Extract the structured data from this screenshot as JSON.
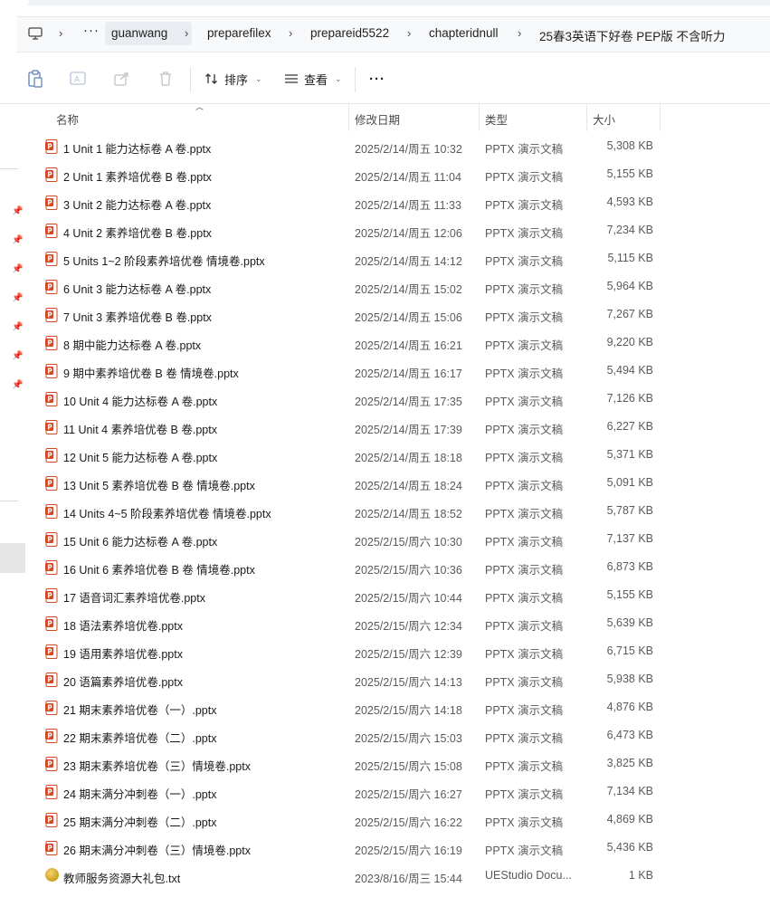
{
  "breadcrumb": {
    "more": "···",
    "items": [
      "guanwang",
      "preparefilex",
      "prepareid5522",
      "chapteridnull",
      "25春3英语下好卷 PEP版 不含听力"
    ]
  },
  "toolbar": {
    "sort_label": "排序",
    "view_label": "查看",
    "more": "···"
  },
  "columns": {
    "name": "名称",
    "date": "修改日期",
    "type": "类型",
    "size": "大小"
  },
  "files": [
    {
      "name": "1 Unit 1 能力达标卷 A 卷.pptx",
      "date": "2025/2/14/周五 10:32",
      "type": "PPTX 演示文稿",
      "size": "5,308 KB",
      "icon": "pptx-icon"
    },
    {
      "name": "2 Unit 1 素养培优卷 B 卷.pptx",
      "date": "2025/2/14/周五 11:04",
      "type": "PPTX 演示文稿",
      "size": "5,155 KB",
      "icon": "pptx-icon"
    },
    {
      "name": "3 Unit 2 能力达标卷 A 卷.pptx",
      "date": "2025/2/14/周五 11:33",
      "type": "PPTX 演示文稿",
      "size": "4,593 KB",
      "icon": "pptx-icon"
    },
    {
      "name": "4 Unit 2 素养培优卷 B 卷.pptx",
      "date": "2025/2/14/周五 12:06",
      "type": "PPTX 演示文稿",
      "size": "7,234 KB",
      "icon": "pptx-icon"
    },
    {
      "name": "5 Units 1~2 阶段素养培优卷 情境卷.pptx",
      "date": "2025/2/14/周五 14:12",
      "type": "PPTX 演示文稿",
      "size": "5,115 KB",
      "icon": "pptx-icon"
    },
    {
      "name": "6 Unit 3 能力达标卷 A 卷.pptx",
      "date": "2025/2/14/周五 15:02",
      "type": "PPTX 演示文稿",
      "size": "5,964 KB",
      "icon": "pptx-icon"
    },
    {
      "name": "7 Unit 3 素养培优卷 B 卷.pptx",
      "date": "2025/2/14/周五 15:06",
      "type": "PPTX 演示文稿",
      "size": "7,267 KB",
      "icon": "pptx-icon"
    },
    {
      "name": "8 期中能力达标卷 A 卷.pptx",
      "date": "2025/2/14/周五 16:21",
      "type": "PPTX 演示文稿",
      "size": "9,220 KB",
      "icon": "pptx-icon"
    },
    {
      "name": "9 期中素养培优卷 B 卷 情境卷.pptx",
      "date": "2025/2/14/周五 16:17",
      "type": "PPTX 演示文稿",
      "size": "5,494 KB",
      "icon": "pptx-icon"
    },
    {
      "name": "10 Unit 4 能力达标卷 A 卷.pptx",
      "date": "2025/2/14/周五 17:35",
      "type": "PPTX 演示文稿",
      "size": "7,126 KB",
      "icon": "pptx-icon"
    },
    {
      "name": "11 Unit 4 素养培优卷 B 卷.pptx",
      "date": "2025/2/14/周五 17:39",
      "type": "PPTX 演示文稿",
      "size": "6,227 KB",
      "icon": "pptx-icon"
    },
    {
      "name": "12 Unit 5 能力达标卷 A 卷.pptx",
      "date": "2025/2/14/周五 18:18",
      "type": "PPTX 演示文稿",
      "size": "5,371 KB",
      "icon": "pptx-icon"
    },
    {
      "name": "13 Unit 5 素养培优卷 B 卷 情境卷.pptx",
      "date": "2025/2/14/周五 18:24",
      "type": "PPTX 演示文稿",
      "size": "5,091 KB",
      "icon": "pptx-icon"
    },
    {
      "name": "14 Units 4~5 阶段素养培优卷 情境卷.pptx",
      "date": "2025/2/14/周五 18:52",
      "type": "PPTX 演示文稿",
      "size": "5,787 KB",
      "icon": "pptx-icon"
    },
    {
      "name": "15 Unit 6 能力达标卷 A 卷.pptx",
      "date": "2025/2/15/周六 10:30",
      "type": "PPTX 演示文稿",
      "size": "7,137 KB",
      "icon": "pptx-icon"
    },
    {
      "name": "16 Unit 6 素养培优卷 B 卷 情境卷.pptx",
      "date": "2025/2/15/周六 10:36",
      "type": "PPTX 演示文稿",
      "size": "6,873 KB",
      "icon": "pptx-icon"
    },
    {
      "name": "17 语音词汇素养培优卷.pptx",
      "date": "2025/2/15/周六 10:44",
      "type": "PPTX 演示文稿",
      "size": "5,155 KB",
      "icon": "pptx-icon"
    },
    {
      "name": "18 语法素养培优卷.pptx",
      "date": "2025/2/15/周六 12:34",
      "type": "PPTX 演示文稿",
      "size": "5,639 KB",
      "icon": "pptx-icon"
    },
    {
      "name": "19 语用素养培优卷.pptx",
      "date": "2025/2/15/周六 12:39",
      "type": "PPTX 演示文稿",
      "size": "6,715 KB",
      "icon": "pptx-icon"
    },
    {
      "name": "20 语篇素养培优卷.pptx",
      "date": "2025/2/15/周六 14:13",
      "type": "PPTX 演示文稿",
      "size": "5,938 KB",
      "icon": "pptx-icon"
    },
    {
      "name": "21 期末素养培优卷（一）.pptx",
      "date": "2025/2/15/周六 14:18",
      "type": "PPTX 演示文稿",
      "size": "4,876 KB",
      "icon": "pptx-icon"
    },
    {
      "name": "22 期末素养培优卷（二）.pptx",
      "date": "2025/2/15/周六 15:03",
      "type": "PPTX 演示文稿",
      "size": "6,473 KB",
      "icon": "pptx-icon"
    },
    {
      "name": "23 期末素养培优卷（三）情境卷.pptx",
      "date": "2025/2/15/周六 15:08",
      "type": "PPTX 演示文稿",
      "size": "3,825 KB",
      "icon": "pptx-icon"
    },
    {
      "name": "24 期末满分冲刺卷（一）.pptx",
      "date": "2025/2/15/周六 16:27",
      "type": "PPTX 演示文稿",
      "size": "7,134 KB",
      "icon": "pptx-icon"
    },
    {
      "name": "25 期末满分冲刺卷（二）.pptx",
      "date": "2025/2/15/周六 16:22",
      "type": "PPTX 演示文稿",
      "size": "4,869 KB",
      "icon": "pptx-icon"
    },
    {
      "name": "26 期末满分冲刺卷（三）情境卷.pptx",
      "date": "2025/2/15/周六 16:19",
      "type": "PPTX 演示文稿",
      "size": "5,436 KB",
      "icon": "pptx-icon"
    },
    {
      "name": "教师服务资源大礼包.txt",
      "date": "2023/8/16/周三 15:44",
      "type": "UEStudio Docu...",
      "size": "1 KB",
      "icon": "txt-file-icon"
    }
  ],
  "colors": {
    "pptx_icon": "#d24726",
    "accent": "#0067c0"
  }
}
